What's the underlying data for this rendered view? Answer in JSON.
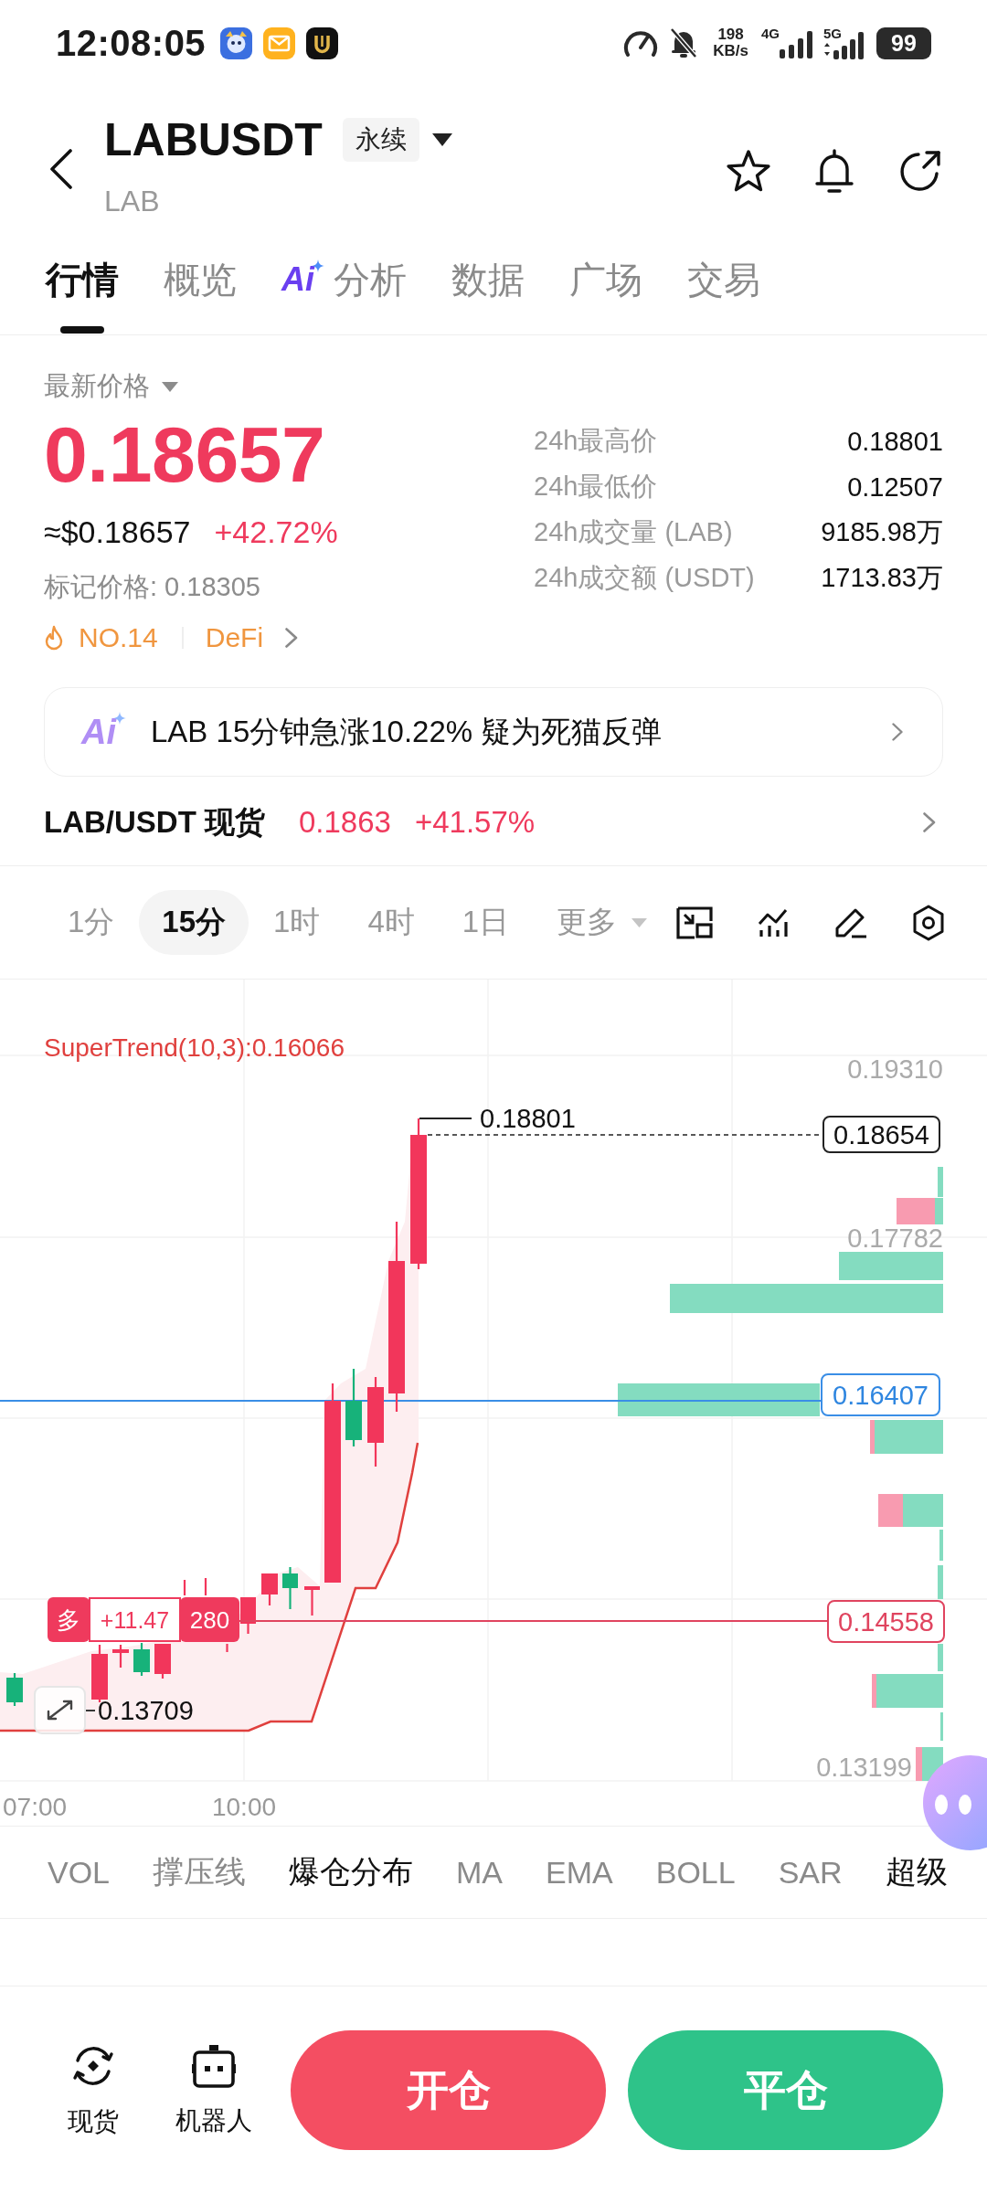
{
  "status_bar": {
    "time": "12:08:05",
    "speed": "198",
    "speed_unit": "KB/s",
    "network_1": "4G",
    "network_2": "5G",
    "battery": "99"
  },
  "header": {
    "symbol": "LABUSDT",
    "contract_type": "永续",
    "base_asset": "LAB"
  },
  "tabs": [
    {
      "label": "行情",
      "kind": "plain",
      "selected": true
    },
    {
      "label": "概览",
      "kind": "plain",
      "selected": false
    },
    {
      "label": "分析",
      "kind": "ai",
      "badge": "Ai",
      "selected": false
    },
    {
      "label": "数据",
      "kind": "plain",
      "selected": false
    },
    {
      "label": "广场",
      "kind": "plain",
      "selected": false
    },
    {
      "label": "交易",
      "kind": "plain",
      "selected": false
    }
  ],
  "price": {
    "label": "最新价格",
    "last": "0.18657",
    "usd": "≈$0.18657",
    "change": "+42.72%",
    "mark": "标记价格: 0.18305",
    "rank": "NO.14",
    "sector": "DeFi"
  },
  "stats": [
    {
      "label": "24h最高价",
      "value": "0.18801"
    },
    {
      "label": "24h最低价",
      "value": "0.12507"
    },
    {
      "label": "24h成交量 (LAB)",
      "value": "9185.98万"
    },
    {
      "label": "24h成交额 (USDT)",
      "value": "1713.83万"
    }
  ],
  "ai_insight": {
    "badge": "Ai",
    "text": "LAB 15分钟急涨10.22% 疑为死猫反弹"
  },
  "spot": {
    "pair": "LAB/USDT 现货",
    "price": "0.1863",
    "change": "+41.57%"
  },
  "timeframes": [
    {
      "label": "1分",
      "kind": "interval",
      "selected": false
    },
    {
      "label": "15分",
      "kind": "interval",
      "selected": true
    },
    {
      "label": "1时",
      "kind": "interval",
      "selected": false
    },
    {
      "label": "4时",
      "kind": "interval",
      "selected": false
    },
    {
      "label": "1日",
      "kind": "interval",
      "selected": false
    },
    {
      "label": "更多",
      "kind": "menu",
      "selected": false
    }
  ],
  "chart": {
    "legend": "SuperTrend(10,3):0.16066",
    "y_axis": [
      "0.19310",
      "0.17782",
      "0.13199"
    ],
    "x_axis": [
      "07:00",
      "10:00"
    ],
    "high": "0.18801",
    "low": "0.13709",
    "last_price": "0.18654",
    "cursor_price": "0.16407",
    "position": {
      "side": "多",
      "pnl": "+11.47",
      "size": "280",
      "price": "0.14558"
    }
  },
  "indicators": [
    {
      "label": "VOL",
      "selected": false
    },
    {
      "label": "撑压线",
      "selected": false
    },
    {
      "label": "爆仓分布",
      "selected": true
    },
    {
      "label": "MA",
      "selected": false
    },
    {
      "label": "EMA",
      "selected": false
    },
    {
      "label": "BOLL",
      "selected": false
    },
    {
      "label": "SAR",
      "selected": false
    },
    {
      "label": "超级",
      "selected": true
    }
  ],
  "bottom_nav": [
    {
      "label": "现货",
      "kind": "spot"
    },
    {
      "label": "机器人",
      "kind": "robot"
    }
  ],
  "actions": [
    {
      "label": "开仓",
      "kind": "open"
    },
    {
      "label": "平仓",
      "kind": "close"
    }
  ]
}
